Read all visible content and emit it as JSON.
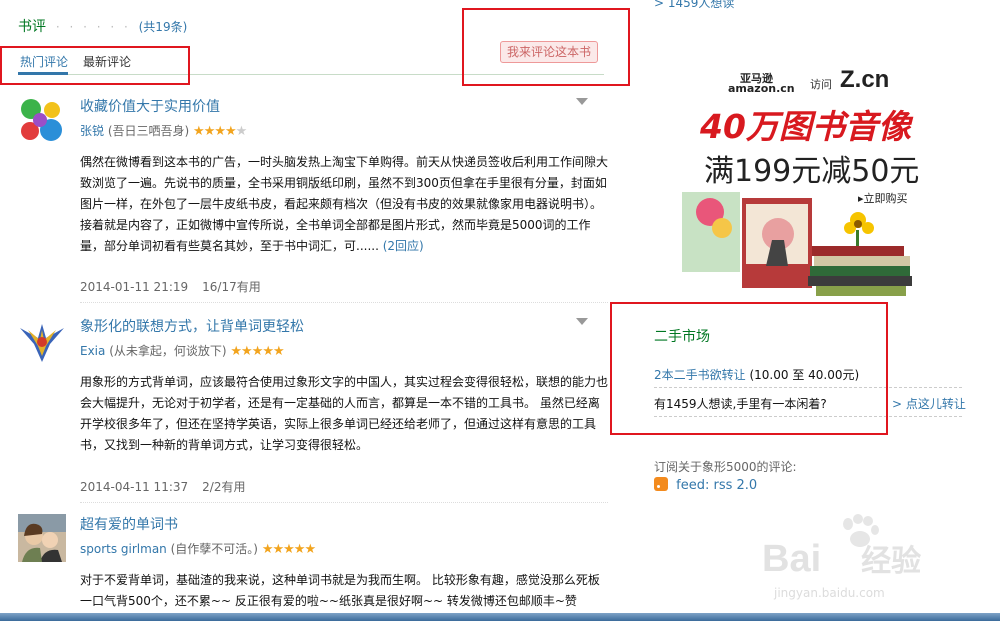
{
  "header": {
    "title": "书评",
    "dots": "· · · · · ·",
    "count": "(共19条)",
    "write_button": "我来评论这本书"
  },
  "tabs": [
    {
      "label": "热门评论",
      "active": true
    },
    {
      "label": "最新评论",
      "active": false
    }
  ],
  "reviews": [
    {
      "title": "收藏价值大于实用价值",
      "author": "张锐",
      "author_note": "(吾日三哂吾身)",
      "rating": 4,
      "body": "偶然在微博看到这本书的广告，一时头脑发热上淘宝下单购得。前天从快递员签收后利用工作间隙大致浏览了一遍。先说书的质量，全书采用铜版纸印刷，虽然不到300页但拿在手里很有分量，封面如图片一样，在外包了一层牛皮纸书皮，看起来颇有档次（但没有书皮的效果就像家用电器说明书）。接着就是内容了，正如微博中宣传所说，全书单词全部都是图片形式，然而毕竟是5000词的工作量，部分单词初看有些莫名其妙，至于书中词汇，可......",
      "reply": "(2回应)",
      "date": "2014-01-11 21:19",
      "useful": "16/17有用"
    },
    {
      "title": "象形化的联想方式，让背单词更轻松",
      "author": "Exia",
      "author_note": "(从未拿起，何谈放下)",
      "rating": 5,
      "body": "用象形的方式背单词，应该最符合使用过象形文字的中国人，其实过程会变得很轻松，联想的能力也会大幅提升，无论对于初学者，还是有一定基础的人而言，都算是一本不错的工具书。 虽然已经离开学校很多年了，但还在坚持学英语，实际上很多单词已经还给老师了，但通过这样有意思的工具书，又找到一种新的背单词方式，让学习变得很轻松。",
      "reply": "",
      "date": "2014-04-11 11:37",
      "useful": "2/2有用"
    },
    {
      "title": "超有爱的单词书",
      "author": "sports girlman",
      "author_note": "(自作孽不可活。)",
      "rating": 5,
      "body": "对于不爱背单词，基础渣的我来说，这种单词书就是为我而生啊。 比较形象有趣，感觉没那么死板 一口气背500个，还不累~~ 反正很有爱的啦~~纸张真是很好啊~~ 转发微博还包邮顺丰~赞",
      "reply": "",
      "date": "",
      "useful": ""
    }
  ],
  "sidebar": {
    "top_link": "> 1459人想读",
    "ad": {
      "logo_amazon": "亚马逊",
      "logo_amazon_en": "amazon.cn",
      "logo_visit": "访问",
      "logo_zcn": "Z.cn",
      "headline": "40万图书音像",
      "subline": "满199元减50元",
      "cta": "▸立即购买"
    },
    "secondhand": {
      "title": "二手市场",
      "offer_link": "2本二手书欲转让",
      "offer_price": "(10.00 至 40.00元)",
      "question": "有1459人想读,手里有一本闲着?",
      "transfer_link": "> 点这儿转让"
    },
    "subscribe": {
      "label": "订阅关于象形5000的评论:",
      "feed": "feed: rss 2.0"
    }
  },
  "watermark": {
    "brand": "Bai",
    "brand_cn": "经验",
    "url": "jingyan.baidu.com"
  },
  "colors": {
    "green": "#007722",
    "link": "#3377aa",
    "star": "#f2a41e",
    "highlight_box": "#e0161f"
  }
}
